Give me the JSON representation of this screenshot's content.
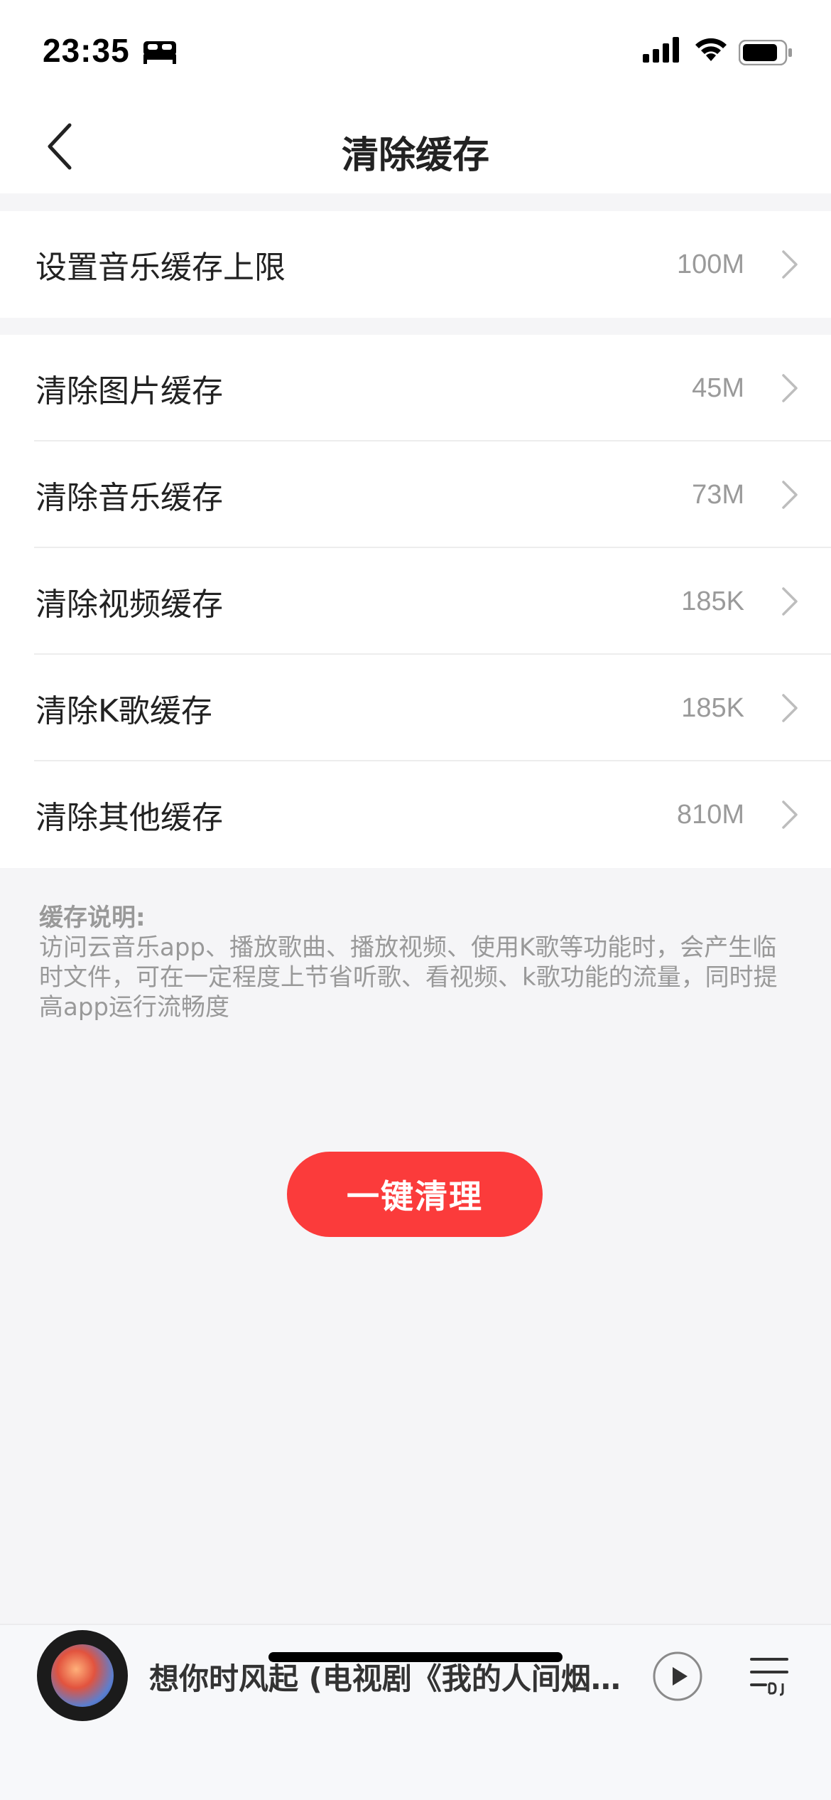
{
  "status_bar": {
    "time": "23:35",
    "icons": [
      "bed-icon",
      "signal-icon",
      "wifi-icon",
      "battery-icon"
    ]
  },
  "nav": {
    "title": "清除缓存",
    "back_icon": "chevron-left-icon"
  },
  "limit_row": {
    "label": "设置音乐缓存上限",
    "value": "100M"
  },
  "cache_rows": [
    {
      "label": "清除图片缓存",
      "value": "45M"
    },
    {
      "label": "清除音乐缓存",
      "value": "73M"
    },
    {
      "label": "清除视频缓存",
      "value": "185K"
    },
    {
      "label": "清除K歌缓存",
      "value": "185K"
    },
    {
      "label": "清除其他缓存",
      "value": "810M"
    }
  ],
  "description": {
    "title": "缓存说明:",
    "body": "访问云音乐app、播放歌曲、播放视频、使用K歌等功能时，会产生临时文件，可在一定程度上节省听歌、看视频、k歌功能的流量，同时提高app运行流畅度"
  },
  "clean_button": {
    "label": "一键清理"
  },
  "mini_player": {
    "song_title": "想你时风起 (电视剧《我的人间烟火》插曲)",
    "icons": [
      "album-art",
      "play-icon",
      "playlist-icon"
    ]
  },
  "colors": {
    "accent": "#fb3b3b",
    "background": "#f5f5f7",
    "secondary_text": "#9a9a9a"
  }
}
